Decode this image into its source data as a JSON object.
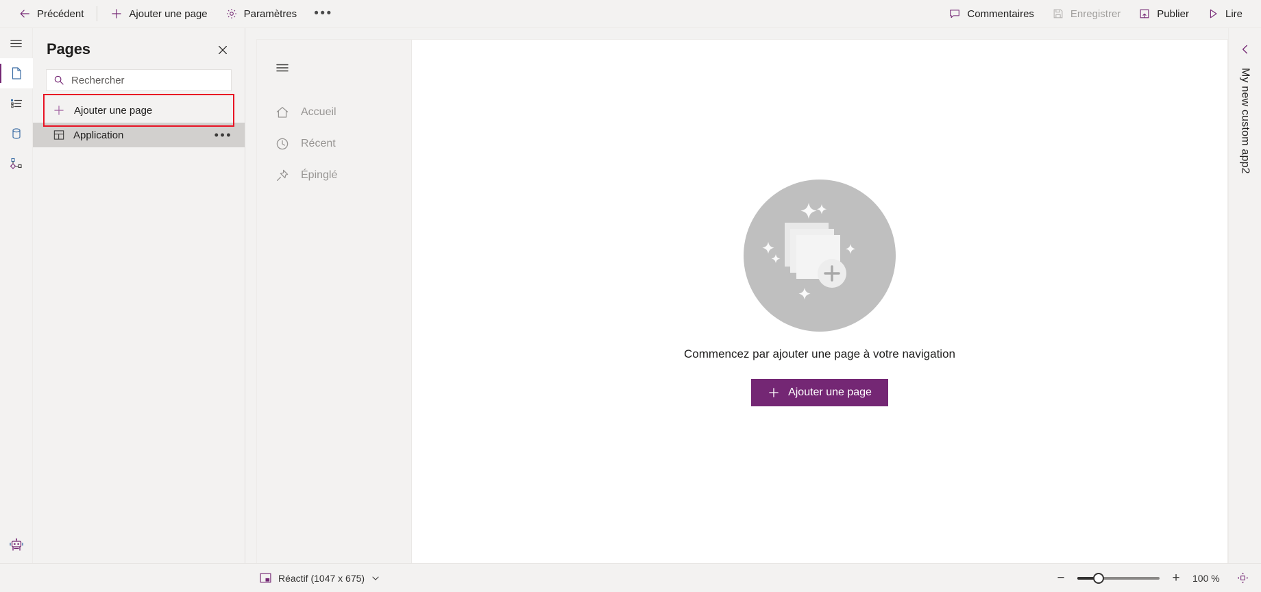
{
  "toolbar": {
    "back_label": "Précédent",
    "add_page_label": "Ajouter une page",
    "settings_label": "Paramètres",
    "overflow_label": "•••",
    "comments_label": "Commentaires",
    "save_label": "Enregistrer",
    "save_disabled": true,
    "publish_label": "Publier",
    "play_label": "Lire"
  },
  "rail": {
    "items": [
      {
        "name": "menu-icon",
        "label": "Menu"
      },
      {
        "name": "pages-icon",
        "label": "Pages",
        "active": true
      },
      {
        "name": "tree-view-icon",
        "label": "Arborescence"
      },
      {
        "name": "data-icon",
        "label": "Données"
      },
      {
        "name": "flows-icon",
        "label": "Flux"
      }
    ],
    "bottom": {
      "name": "copilot-robot-icon",
      "label": "Copilot"
    }
  },
  "pages_panel": {
    "title": "Pages",
    "close_label": "Fermer",
    "search": {
      "placeholder": "Rechercher",
      "value": ""
    },
    "add_page_label": "Ajouter une page",
    "add_page_highlighted": true,
    "highlight_color": "#e81123",
    "tree": [
      {
        "label": "Application",
        "icon": "app-layout-icon",
        "selected": true,
        "overflow": "•••"
      }
    ]
  },
  "preview": {
    "nav": {
      "menu_icon": "hamburger-icon",
      "items": [
        {
          "label": "Accueil",
          "icon": "home-icon"
        },
        {
          "label": "Récent",
          "icon": "clock-icon"
        },
        {
          "label": "Épinglé",
          "icon": "pin-icon"
        }
      ]
    },
    "empty_state": {
      "illustration": "stacked-pages-plus-illustration",
      "message": "Commencez par ajouter une page à votre navigation",
      "button_label": "Ajouter une page",
      "button_color": "#742774"
    }
  },
  "right_rail": {
    "collapse_icon": "chevron-left-icon",
    "app_name": "My new custom app2"
  },
  "statusbar": {
    "screen_label": "Réactif (1047 x 675)",
    "screen_icon": "responsive-screen-icon",
    "chevron": "chevron-down-icon",
    "zoom_out_label": "−",
    "zoom_in_label": "+",
    "zoom_value": "100 %",
    "fit_icon": "fit-to-screen-icon"
  }
}
